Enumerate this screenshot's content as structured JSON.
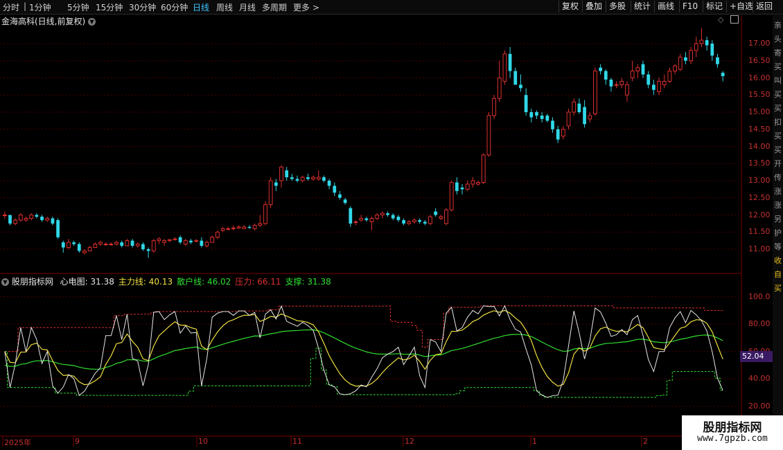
{
  "toolbar": {
    "periods": [
      "分时",
      "1分钟",
      "5分钟",
      "15分钟",
      "30分钟",
      "60分钟",
      "日线",
      "周线",
      "月线",
      "多周期",
      "更多"
    ],
    "active_period": "日线",
    "right_buttons": [
      "复权",
      "叠加",
      "多股",
      "统计",
      "画线",
      "F10",
      "标记",
      "+自选",
      "返回"
    ]
  },
  "stock": {
    "title": "金海高科(日线,前复权)"
  },
  "indicator": {
    "name": "股朋指标网",
    "items": [
      {
        "label": "心电图:",
        "value": "31.38",
        "color": "#e8e8e8"
      },
      {
        "label": "主力线:",
        "value": "40.13",
        "color": "#f0e040"
      },
      {
        "label": "散户线:",
        "value": "46.02",
        "color": "#30e030"
      },
      {
        "label": "压力:",
        "value": "66.11",
        "color": "#e03030"
      },
      {
        "label": "支撑:",
        "value": "31.38",
        "color": "#30e030"
      }
    ],
    "current_value": "52.04"
  },
  "price_axis": [
    "17.00",
    "16.50",
    "16.00",
    "15.50",
    "15.00",
    "14.50",
    "14.00",
    "13.50",
    "13.00",
    "12.50",
    "12.00",
    "11.50",
    "11.00"
  ],
  "indicator_axis": [
    "100.0",
    "80.00",
    "60.00",
    "40.00",
    "20.00"
  ],
  "date_axis": [
    "2025年",
    "9",
    "10",
    "11",
    "12",
    "1",
    "2"
  ],
  "sidebar_chars": [
    "亲",
    "头",
    "寄",
    "买",
    "叫",
    "买",
    "买",
    "扣",
    "买",
    "买",
    "开",
    "传",
    "涨",
    "涨",
    "另",
    "护",
    "等",
    "收",
    "自",
    "买"
  ],
  "watermark": {
    "line1": "股朋指标网",
    "line2": "www.7gpzb.com"
  },
  "colors": {
    "up": "#e03030",
    "down": "#30d8e8",
    "grid": "#5a0000",
    "heart": "#e8e8e8",
    "main": "#f0e040",
    "retail": "#30e030",
    "pressure": "#e03030",
    "support": "#30e030"
  },
  "chart_data": {
    "type": "candlestick",
    "ylim": [
      10.6,
      17.5
    ],
    "candles": [
      [
        12.0,
        12.1,
        11.9,
        12.0
      ],
      [
        12.0,
        12.0,
        11.7,
        11.75
      ],
      [
        11.75,
        11.9,
        11.7,
        11.85
      ],
      [
        11.85,
        12.05,
        11.8,
        12.0
      ],
      [
        11.85,
        11.95,
        11.8,
        11.9
      ],
      [
        11.9,
        12.05,
        11.85,
        12.0
      ],
      [
        12.0,
        12.05,
        11.9,
        11.95
      ],
      [
        11.95,
        12.0,
        11.8,
        11.85
      ],
      [
        11.85,
        11.95,
        11.8,
        11.9
      ],
      [
        11.9,
        11.95,
        11.7,
        11.75
      ],
      [
        11.85,
        11.9,
        11.3,
        11.35
      ],
      [
        11.2,
        11.25,
        10.9,
        11.05
      ],
      [
        11.05,
        11.3,
        11.0,
        11.2
      ],
      [
        11.2,
        11.25,
        11.1,
        11.15
      ],
      [
        11.15,
        11.2,
        10.9,
        10.95
      ],
      [
        10.9,
        11.0,
        10.85,
        10.95
      ],
      [
        10.95,
        11.1,
        10.95,
        11.05
      ],
      [
        11.05,
        11.2,
        11.05,
        11.15
      ],
      [
        11.15,
        11.25,
        11.1,
        11.2
      ],
      [
        11.15,
        11.2,
        11.1,
        11.15
      ],
      [
        11.15,
        11.2,
        11.1,
        11.15
      ],
      [
        11.15,
        11.25,
        11.1,
        11.2
      ],
      [
        11.2,
        11.25,
        11.05,
        11.1
      ],
      [
        11.1,
        11.3,
        11.1,
        11.25
      ],
      [
        11.25,
        11.3,
        11.05,
        11.1
      ],
      [
        11.1,
        11.2,
        11.05,
        11.15
      ],
      [
        11.15,
        11.2,
        10.95,
        11.0
      ],
      [
        11.0,
        11.05,
        10.75,
        10.95
      ],
      [
        10.95,
        11.3,
        10.9,
        11.25
      ],
      [
        11.25,
        11.35,
        11.15,
        11.3
      ],
      [
        11.2,
        11.3,
        11.1,
        11.25
      ],
      [
        11.25,
        11.3,
        11.2,
        11.28
      ],
      [
        11.3,
        11.35,
        11.25,
        11.3
      ],
      [
        11.35,
        11.4,
        11.15,
        11.2
      ],
      [
        11.15,
        11.3,
        11.1,
        11.25
      ],
      [
        11.25,
        11.3,
        11.15,
        11.2
      ],
      [
        11.25,
        11.3,
        11.2,
        11.25
      ],
      [
        11.25,
        11.35,
        11.05,
        11.1
      ],
      [
        11.1,
        11.25,
        11.05,
        11.2
      ],
      [
        11.2,
        11.4,
        11.2,
        11.35
      ],
      [
        11.35,
        11.55,
        11.3,
        11.5
      ],
      [
        11.55,
        11.65,
        11.5,
        11.6
      ],
      [
        11.6,
        11.65,
        11.55,
        11.6
      ],
      [
        11.6,
        11.7,
        11.55,
        11.62
      ],
      [
        11.62,
        11.7,
        11.6,
        11.65
      ],
      [
        11.6,
        11.7,
        11.6,
        11.65
      ],
      [
        11.65,
        11.7,
        11.6,
        11.62
      ],
      [
        11.6,
        11.75,
        11.55,
        11.7
      ],
      [
        11.7,
        12.0,
        11.65,
        11.75
      ],
      [
        11.75,
        12.4,
        11.7,
        12.3
      ],
      [
        12.3,
        13.1,
        12.2,
        13.0
      ],
      [
        12.95,
        13.05,
        12.7,
        12.85
      ],
      [
        13.0,
        13.45,
        12.8,
        13.4
      ],
      [
        13.3,
        13.4,
        13.0,
        13.1
      ],
      [
        13.1,
        13.2,
        13.0,
        13.05
      ],
      [
        13.05,
        13.15,
        12.95,
        13.0
      ],
      [
        13.0,
        13.15,
        12.95,
        13.1
      ],
      [
        13.1,
        13.2,
        13.0,
        13.05
      ],
      [
        13.05,
        13.15,
        13.0,
        13.1
      ],
      [
        13.05,
        13.3,
        13.0,
        13.1
      ],
      [
        13.1,
        13.15,
        12.95,
        13.0
      ],
      [
        13.0,
        13.05,
        12.75,
        12.85
      ],
      [
        12.85,
        12.95,
        12.55,
        12.65
      ],
      [
        12.6,
        12.7,
        12.45,
        12.5
      ],
      [
        12.45,
        12.5,
        12.3,
        12.35
      ],
      [
        12.2,
        12.25,
        11.65,
        11.75
      ],
      [
        11.8,
        11.85,
        11.7,
        11.8
      ],
      [
        11.85,
        12.0,
        11.8,
        11.9
      ],
      [
        11.9,
        11.95,
        11.8,
        11.85
      ],
      [
        11.8,
        11.95,
        11.55,
        11.9
      ],
      [
        11.9,
        12.05,
        11.85,
        12.0
      ],
      [
        12.0,
        12.1,
        11.9,
        12.05
      ],
      [
        12.05,
        12.1,
        11.95,
        12.0
      ],
      [
        12.0,
        12.05,
        11.85,
        11.9
      ],
      [
        11.95,
        12.0,
        11.8,
        11.85
      ],
      [
        11.85,
        11.9,
        11.7,
        11.75
      ],
      [
        11.75,
        11.85,
        11.7,
        11.8
      ],
      [
        11.8,
        11.9,
        11.75,
        11.85
      ],
      [
        11.85,
        11.9,
        11.75,
        11.8
      ],
      [
        11.8,
        11.85,
        11.7,
        11.75
      ],
      [
        11.75,
        12.0,
        11.7,
        11.95
      ],
      [
        12.1,
        12.2,
        11.95,
        12.0
      ],
      [
        11.9,
        12.0,
        11.85,
        11.95
      ],
      [
        11.75,
        12.2,
        11.7,
        12.15
      ],
      [
        12.15,
        13.0,
        12.1,
        12.95
      ],
      [
        12.95,
        13.1,
        12.6,
        12.7
      ],
      [
        12.8,
        12.9,
        12.6,
        12.75
      ],
      [
        12.75,
        13.0,
        12.7,
        12.9
      ],
      [
        12.9,
        13.1,
        12.8,
        13.0
      ],
      [
        12.9,
        13.0,
        12.85,
        12.95
      ],
      [
        12.95,
        13.8,
        12.9,
        13.75
      ],
      [
        13.75,
        15.0,
        13.7,
        14.9
      ],
      [
        14.9,
        15.5,
        14.8,
        15.4
      ],
      [
        15.4,
        16.5,
        15.3,
        16.0
      ],
      [
        15.9,
        16.8,
        15.8,
        16.7
      ],
      [
        16.7,
        16.9,
        16.0,
        16.2
      ],
      [
        16.2,
        16.3,
        15.8,
        15.8
      ],
      [
        15.8,
        16.1,
        15.6,
        15.7
      ],
      [
        15.5,
        15.7,
        14.9,
        15.0
      ],
      [
        15.0,
        15.1,
        14.7,
        14.85
      ],
      [
        15.0,
        15.05,
        14.8,
        14.9
      ],
      [
        14.9,
        15.0,
        14.7,
        14.8
      ],
      [
        14.9,
        14.95,
        14.7,
        14.75
      ],
      [
        14.75,
        14.85,
        14.4,
        14.5
      ],
      [
        14.5,
        14.6,
        14.1,
        14.2
      ],
      [
        14.3,
        14.6,
        14.2,
        14.5
      ],
      [
        14.6,
        15.1,
        14.5,
        15.0
      ],
      [
        15.0,
        15.4,
        14.9,
        15.3
      ],
      [
        15.25,
        15.4,
        14.95,
        15.0
      ],
      [
        15.15,
        15.35,
        14.55,
        14.65
      ],
      [
        14.8,
        15.0,
        14.7,
        14.9
      ],
      [
        14.95,
        16.3,
        14.9,
        16.2
      ],
      [
        16.3,
        16.4,
        16.1,
        16.2
      ],
      [
        16.2,
        16.25,
        15.8,
        15.95
      ],
      [
        15.95,
        16.0,
        15.6,
        15.75
      ],
      [
        15.8,
        15.9,
        15.7,
        15.8
      ],
      [
        15.8,
        16.0,
        15.7,
        15.9
      ],
      [
        15.5,
        15.9,
        15.3,
        15.8
      ],
      [
        16.0,
        16.5,
        15.9,
        16.2
      ],
      [
        16.2,
        16.4,
        16.0,
        16.3
      ],
      [
        16.4,
        16.5,
        16.0,
        16.1
      ],
      [
        16.1,
        16.2,
        15.7,
        15.8
      ],
      [
        15.8,
        15.95,
        15.5,
        15.65
      ],
      [
        15.6,
        16.0,
        15.5,
        15.9
      ],
      [
        15.8,
        16.1,
        15.7,
        15.9
      ],
      [
        15.9,
        16.3,
        15.85,
        16.2
      ],
      [
        16.2,
        16.4,
        16.1,
        16.35
      ],
      [
        16.25,
        16.7,
        16.2,
        16.6
      ],
      [
        16.6,
        16.75,
        16.4,
        16.5
      ],
      [
        16.5,
        16.9,
        16.4,
        16.8
      ],
      [
        16.8,
        17.2,
        16.6,
        17.0
      ],
      [
        17.0,
        17.45,
        16.9,
        17.1
      ],
      [
        17.1,
        17.2,
        16.8,
        16.95
      ],
      [
        17.0,
        17.1,
        16.5,
        16.65
      ],
      [
        16.6,
        16.7,
        16.3,
        16.4
      ],
      [
        16.15,
        16.2,
        15.9,
        16.05
      ]
    ]
  }
}
